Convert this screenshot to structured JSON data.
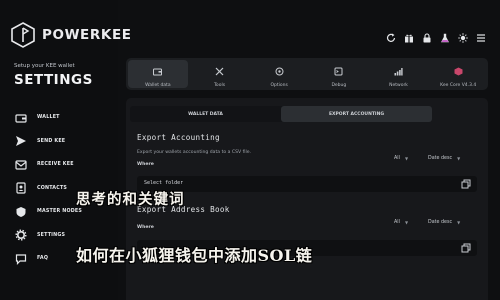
{
  "brand": {
    "name": "POWERKEE"
  },
  "sidebar": {
    "subtitle": "Setup your KEE wallet",
    "section_title": "SETTINGS",
    "items": [
      {
        "label": "WALLET",
        "icon": "wallet-icon"
      },
      {
        "label": "SEND KEE",
        "icon": "send-icon"
      },
      {
        "label": "RECEIVE KEE",
        "icon": "receive-icon"
      },
      {
        "label": "CONTACTS",
        "icon": "contacts-icon"
      },
      {
        "label": "MASTER NODES",
        "icon": "shield-icon"
      },
      {
        "label": "SETTINGS",
        "icon": "gear-icon"
      },
      {
        "label": "FAQ",
        "icon": "chat-icon"
      }
    ]
  },
  "topbar": {
    "icons": [
      "refresh-icon",
      "gift-icon",
      "lock-icon",
      "flask-icon",
      "sun-icon",
      "menu-icon"
    ]
  },
  "tabs": [
    {
      "label": "Wallet data",
      "icon": "wallet-icon"
    },
    {
      "label": "Tools",
      "icon": "tools-icon"
    },
    {
      "label": "Options",
      "icon": "options-icon"
    },
    {
      "label": "Debug",
      "icon": "debug-icon"
    },
    {
      "label": "Network",
      "icon": "network-icon"
    },
    {
      "label": "Kee Core V4.3.4",
      "icon": "core-icon"
    }
  ],
  "subtabs": [
    "WALLET DATA",
    "EXPORT ACCOUNTING"
  ],
  "export_accounting": {
    "title": "Export Accounting",
    "description": "Export your wallets accounting data to a CSV file.",
    "where_label": "Where",
    "filter_all": "All",
    "filter_sort": "Date desc",
    "select_folder": "Select folder"
  },
  "export_address_book": {
    "title": "Export Address Book",
    "where_label": "Where",
    "filter_all": "All",
    "filter_sort": "Date desc"
  },
  "overlay": {
    "line1": "思考的和关键词",
    "line2": "如何在小狐狸钱包中添加SOL链"
  },
  "colors": {
    "background": "#0e0f11",
    "panel": "#17181b",
    "active_tab": "#2c2f33"
  }
}
